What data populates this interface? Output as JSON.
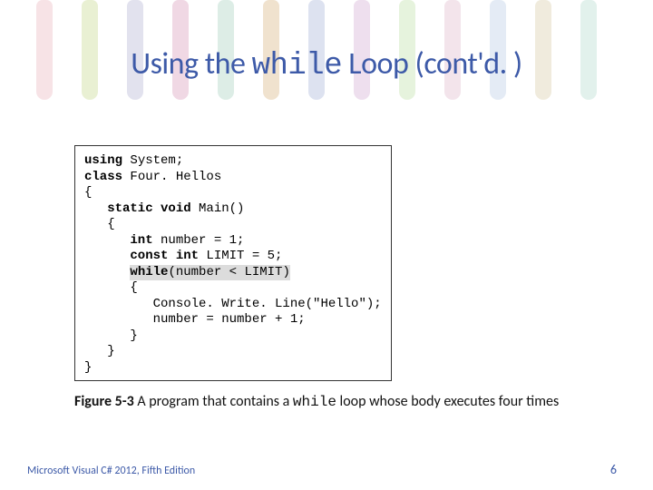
{
  "title": {
    "prefix": "Using the ",
    "mono": "while",
    "suffix": " Loop (cont'd. )"
  },
  "code": {
    "l1a": "using",
    "l1b": " System;",
    "l2a": "class",
    "l2b": " Four. Hellos",
    "l3": "{",
    "l4a": "   static void",
    "l4b": " Main()",
    "l5": "   {",
    "l6a": "      int",
    "l6b": " number = 1;",
    "l7a": "      const int",
    "l7b": " LIMIT = 5;",
    "l8p": "      ",
    "l8a": "while",
    "l8b": "(number < LIMIT)",
    "l9": "      {",
    "l10": "         Console. Write. Line(\"Hello\");",
    "l11": "         number = number + 1;",
    "l12": "      }",
    "l13": "   }",
    "l14": "}"
  },
  "caption": {
    "fig": "Figure 5-3",
    "before": "  A program that contains a ",
    "mono": "while",
    "after": " loop whose body executes four times"
  },
  "footer": {
    "left": "Microsoft Visual C# 2012, Fifth Edition",
    "page": "6"
  },
  "decor": {
    "stripe_colors": [
      "#e8a5b0",
      "#b8d070",
      "#a0a0c8",
      "#d080a8",
      "#90c7b0",
      "#d0a060",
      "#90a0d0",
      "#c898c8",
      "#b0d890",
      "#d8a8c0",
      "#a8c0e0",
      "#d0c090",
      "#a0d0c0",
      "#d898b8"
    ]
  }
}
